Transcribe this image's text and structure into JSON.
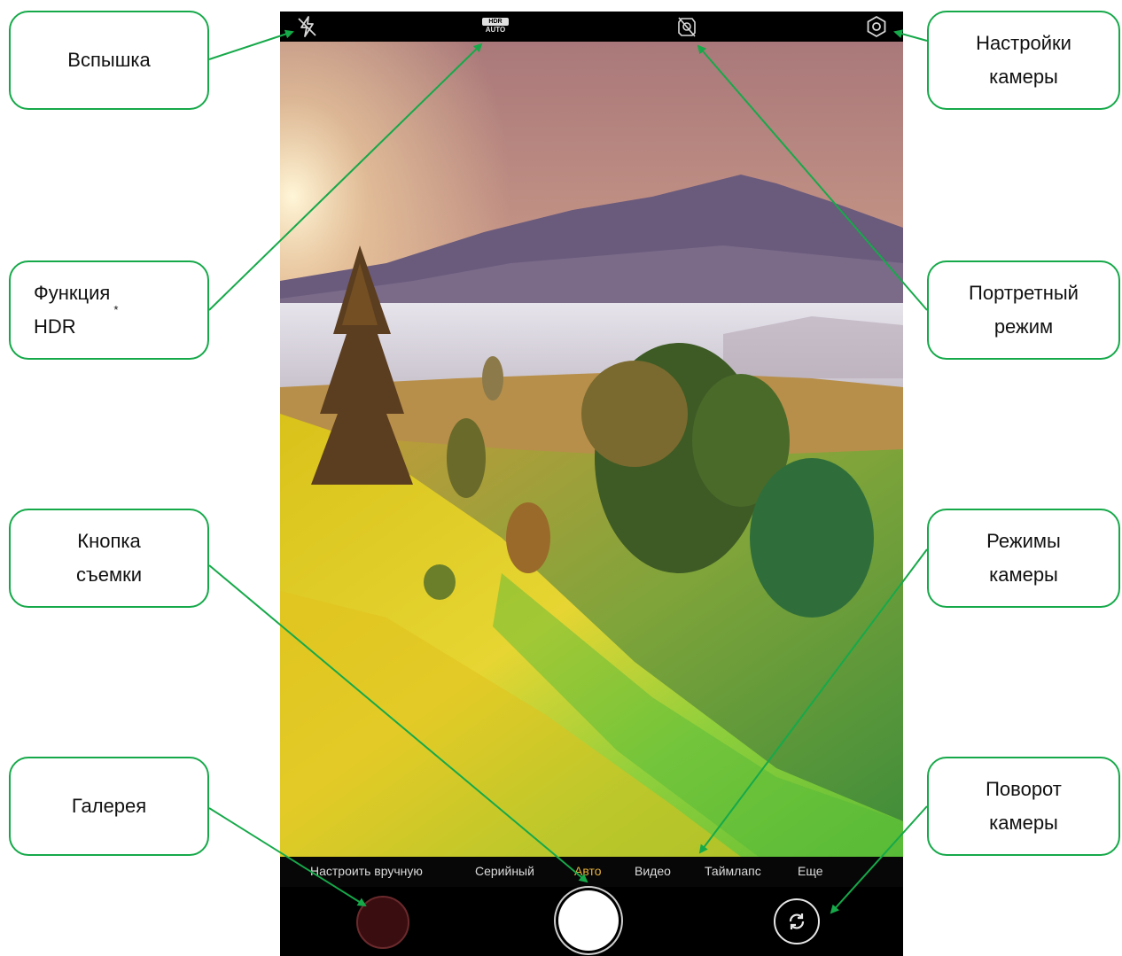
{
  "camera": {
    "top_bar": {
      "flash_icon": "flash-off-icon",
      "hdr_badge_top": "HDR",
      "hdr_badge_bottom": "AUTO",
      "portrait_icon": "portrait-off-icon",
      "settings_icon": "gear-icon"
    },
    "modes": [
      {
        "label": "Настроить вручную",
        "active": false
      },
      {
        "label": "Серийный",
        "active": false
      },
      {
        "label": "Авто",
        "active": true
      },
      {
        "label": "Видео",
        "active": false
      },
      {
        "label": "Таймлапс",
        "active": false
      },
      {
        "label": "Еще",
        "active": false
      }
    ],
    "active_mode_color": "#e8b23a",
    "bottom_bar": {
      "gallery_thumb_color": "#3a0d10",
      "shutter_color": "#ffffff",
      "switch_icon": "rotate-camera-icon"
    }
  },
  "callouts": {
    "flash": "Вспышка",
    "hdr": "Функция\nHDR",
    "hdr_mark": "*",
    "settings": "Настройки\nкамеры",
    "portrait": "Портретный\nрежим",
    "shutter": "Кнопка\nсъемки",
    "modes": "Режимы\nкамеры",
    "gallery": "Галерея",
    "rotate": "Поворот\nкамеры"
  },
  "colors": {
    "callout_border": "#16a94a",
    "arrow": "#16a94a"
  }
}
